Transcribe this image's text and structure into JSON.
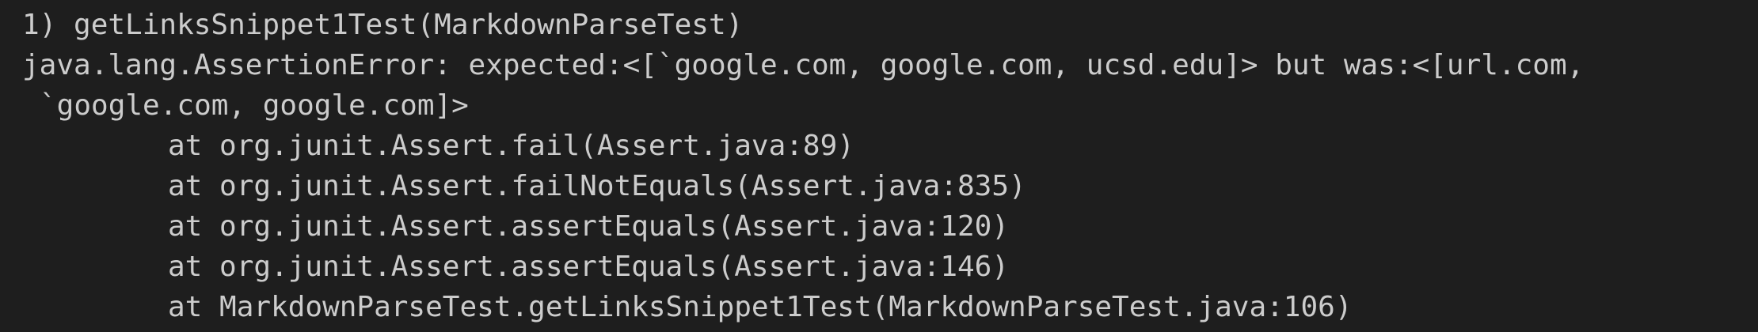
{
  "terminal": {
    "lines": [
      {
        "text": "1) getLinksSnippet1Test(MarkdownParseTest)",
        "kind": "header"
      },
      {
        "text": "java.lang.AssertionError: expected:<[`google.com, google.com, ucsd.edu]> but was:<[url.com,",
        "kind": "error"
      },
      {
        "text": "`google.com, google.com]>",
        "kind": "wrap"
      },
      {
        "text": "at org.junit.Assert.fail(Assert.java:89)",
        "kind": "stack"
      },
      {
        "text": "at org.junit.Assert.failNotEquals(Assert.java:835)",
        "kind": "stack"
      },
      {
        "text": "at org.junit.Assert.assertEquals(Assert.java:120)",
        "kind": "stack"
      },
      {
        "text": "at org.junit.Assert.assertEquals(Assert.java:146)",
        "kind": "stack"
      },
      {
        "text": "at MarkdownParseTest.getLinksSnippet1Test(MarkdownParseTest.java:106)",
        "kind": "stack"
      }
    ]
  },
  "colors": {
    "background": "#1e1e1e",
    "text": "#cccccc"
  }
}
